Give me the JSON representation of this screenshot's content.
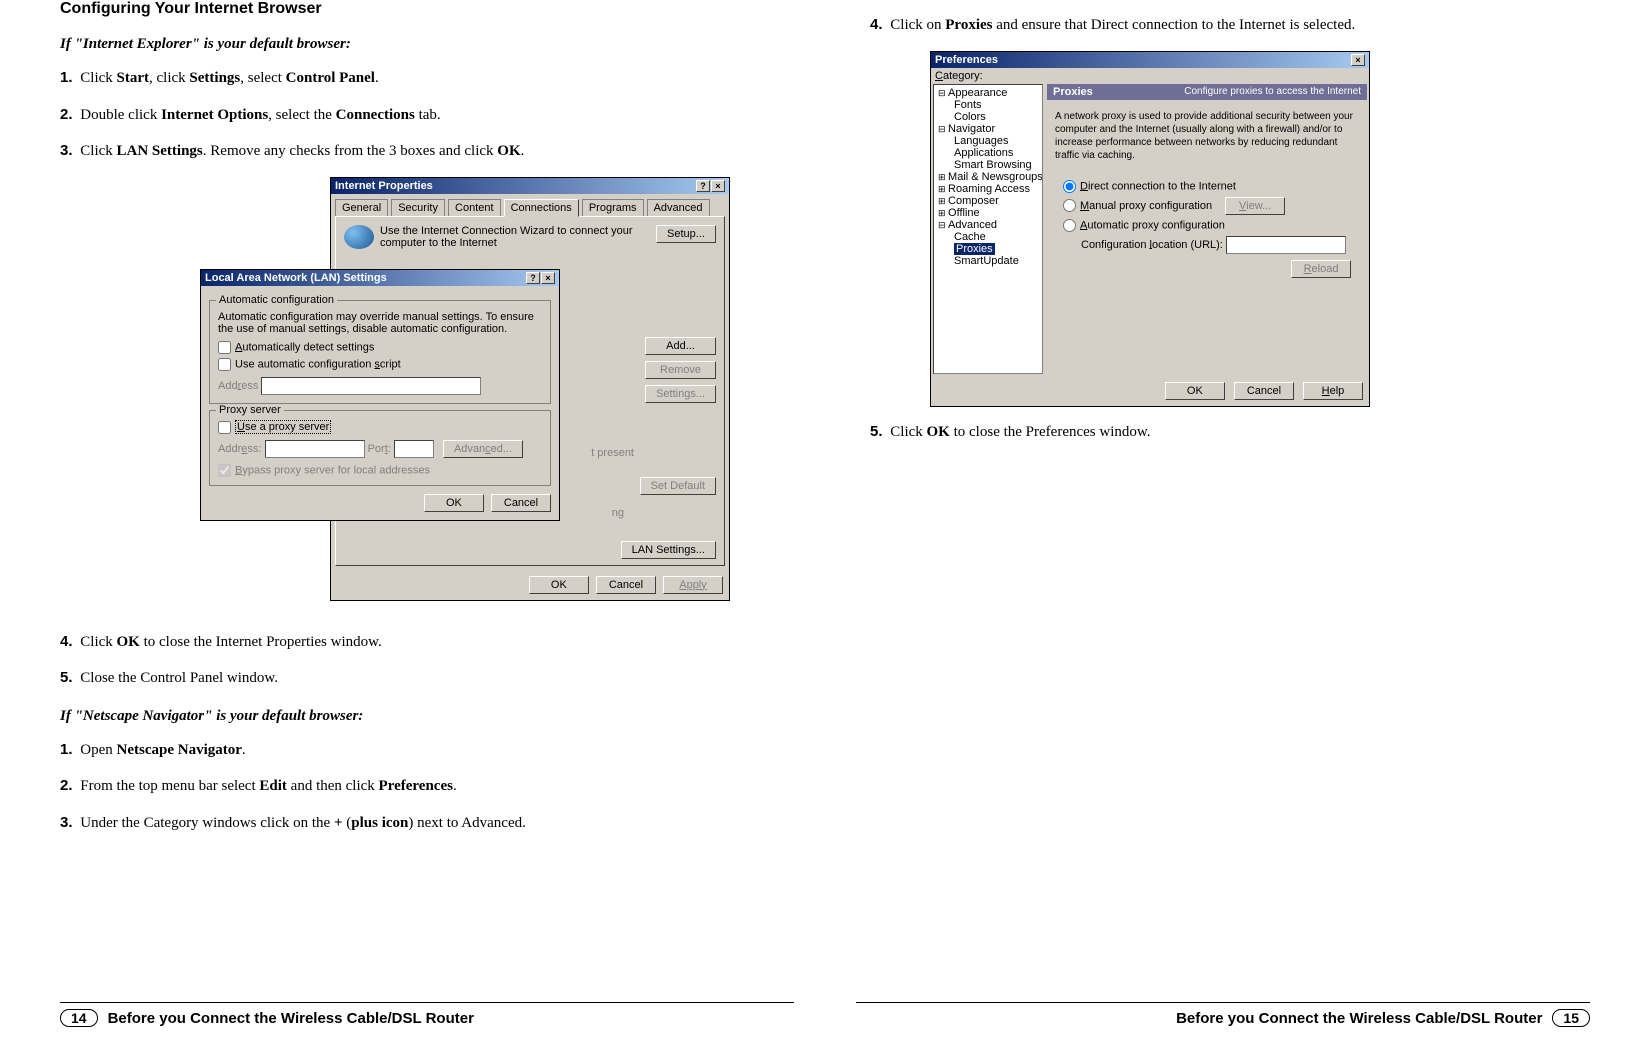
{
  "left": {
    "heading": "Configuring Your Internet Browser",
    "ie_sub": "If \"Internet Explorer\" is your default browser:",
    "steps_ie": {
      "s1_pre": "Click ",
      "s1_b1": "Start",
      "s1_mid1": ", click ",
      "s1_b2": "Settings",
      "s1_mid2": ", select ",
      "s1_b3": "Control Panel",
      "s1_end": ".",
      "s2_pre": "Double click ",
      "s2_b1": "Internet Options",
      "s2_mid": ", select the ",
      "s2_b2": "Connections",
      "s2_end": " tab.",
      "s3_pre": "Click ",
      "s3_b1": "LAN Settings",
      "s3_mid": ". Remove any checks from the 3 boxes and click ",
      "s3_b2": "OK",
      "s3_end": ".",
      "s4_pre": "Click ",
      "s4_b1": "OK",
      "s4_end": " to close the Internet Properties window.",
      "s5": "Close the Control Panel window."
    },
    "ns_sub": "If \"Netscape Navigator\" is your default browser:",
    "steps_ns": {
      "s1_pre": "Open ",
      "s1_b1": "Netscape Navigator",
      "s1_end": ".",
      "s2_pre": "From the top menu bar select ",
      "s2_b1": "Edit",
      "s2_mid": " and then click ",
      "s2_b2": "Preferences",
      "s2_end": ".",
      "s3_pre": "Under the Category windows click on the ",
      "s3_b1": "+",
      "s3_mid": " (",
      "s3_b2": "plus icon",
      "s3_end": ") next to Advanced."
    }
  },
  "right": {
    "s4_pre": "Click on ",
    "s4_b1": "Proxies",
    "s4_end": " and ensure that Direct connection to the Internet is selected.",
    "s5_pre": "Click ",
    "s5_b1": "OK",
    "s5_end": " to close the Preferences window."
  },
  "dlg_ie": {
    "title": "Internet Properties",
    "tabs": {
      "general": "General",
      "security": "Security",
      "content": "Content",
      "connections": "Connections",
      "programs": "Programs",
      "advanced": "Advanced"
    },
    "wizard_text": "Use the Internet Connection Wizard to connect your computer to the Internet",
    "setup_btn": "Setup...",
    "add_btn": "Add...",
    "remove_btn": "Remove",
    "settings_btn": "Settings...",
    "notpresent": "t present",
    "setdef_btn": "Set Default",
    "ng": "ng",
    "lan_btn": "LAN Settings...",
    "ok": "OK",
    "cancel": "Cancel",
    "apply": "Apply"
  },
  "dlg_lan": {
    "title": "Local Area Network (LAN) Settings",
    "auto_title": "Automatic configuration",
    "auto_desc": "Automatic configuration may override manual settings. To ensure the use of manual settings, disable automatic configuration.",
    "chk1": "Automatically detect settings",
    "chk2": "Use automatic configuration script",
    "addr_lbl": "Address",
    "proxy_title": "Proxy server",
    "proxy_chk": "Use a proxy server",
    "proxy_addr": "Address:",
    "proxy_port": "Port:",
    "adv_btn": "Advanced...",
    "bypass": "Bypass proxy server for local addresses",
    "ok": "OK",
    "cancel": "Cancel"
  },
  "dlg_pref": {
    "title": "Preferences",
    "cat_lbl": "Category:",
    "tree": {
      "appearance": "Appearance",
      "fonts": "Fonts",
      "colors": "Colors",
      "navigator": "Navigator",
      "languages": "Languages",
      "applications": "Applications",
      "smart": "Smart Browsing",
      "mail": "Mail & Newsgroups",
      "roaming": "Roaming Access",
      "composer": "Composer",
      "offline": "Offline",
      "advanced": "Advanced",
      "cache": "Cache",
      "proxies": "Proxies",
      "smartupdate": "SmartUpdate"
    },
    "header_l": "Proxies",
    "header_r": "Configure proxies to access the Internet",
    "desc": "A network proxy is used to provide additional security between your computer and the Internet (usually along with a firewall) and/or to increase performance between networks by reducing redundant traffic via caching.",
    "opt1": "Direct connection to the Internet",
    "opt2": "Manual proxy configuration",
    "view_btn": "View...",
    "opt3": "Automatic proxy configuration",
    "url_lbl": "Configuration location (URL):",
    "reload_btn": "Reload",
    "ok": "OK",
    "cancel": "Cancel",
    "help": "Help"
  },
  "footer": {
    "left_num": "14",
    "left_text": "Before you Connect the Wireless Cable/DSL Router",
    "right_text": "Before you Connect the Wireless Cable/DSL Router",
    "right_num": "15"
  }
}
